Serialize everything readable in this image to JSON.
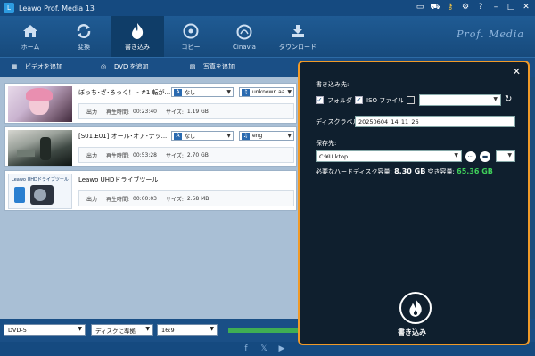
{
  "app": {
    "title": "Leawo Prof. Media 13",
    "brand": "Prof. Media"
  },
  "nav": [
    {
      "label": "ホーム"
    },
    {
      "label": "変換"
    },
    {
      "label": "書き込み"
    },
    {
      "label": "コピー"
    },
    {
      "label": "Cinavia"
    },
    {
      "label": "ダウンロード"
    }
  ],
  "toolbar": {
    "add_video": "ビデオを追加",
    "add_dvd": "DVD を追加",
    "add_photo": "写真を追加"
  },
  "items": [
    {
      "name": "ぼっち･ざ･ろっく！ - #1 転が...",
      "output_label": "出力",
      "duration_label": "再生時間:",
      "duration": "00:23:40",
      "size_label": "サイズ:",
      "size": "1.19 GB",
      "subtitle": "なし",
      "audio": "unknown aa"
    },
    {
      "name": "[S01.E01] オール･オア･ナッ...",
      "output_label": "出力",
      "duration_label": "再生時間:",
      "duration": "00:53:28",
      "size_label": "サイズ:",
      "size": "2.70 GB",
      "subtitle": "なし",
      "audio": "eng"
    },
    {
      "name": "Leawo UHDドライブツール",
      "output_label": "出力",
      "duration_label": "再生時間:",
      "duration": "00:00:03",
      "size_label": "サイズ:",
      "size": "2.58 MB",
      "thumb_text": "Leawo UHDドライブツール"
    }
  ],
  "bottom": {
    "disc_type": "DVD-5",
    "fit": "ディスクに準拠",
    "aspect": "16:9",
    "progress": 1.0
  },
  "dialog": {
    "burn_to_label": "書き込み先:",
    "folder_label": "フォルダ",
    "iso_label": "ISO ファイル",
    "folder_checked": true,
    "iso_checked": true,
    "drive_checked": false,
    "disc_label_title": "ディスクラベル:",
    "disc_label_value": "20250604_14_11_26",
    "save_to_label": "保存先:",
    "save_path": "C:¥U                ktop",
    "more_btn": "···",
    "req_space_label": "必要なハードディスク容量:",
    "req_space_value": "8.30 GB",
    "free_space_label": "空き容量:",
    "free_space_value": "65.36 GB",
    "burn_label": "書き込み"
  },
  "colors": {
    "accent": "#f09a28",
    "free_space": "#3fcf5a",
    "nav_active": "#0f3d68"
  },
  "icons": {
    "nav": [
      "home-icon",
      "convert-icon",
      "burn-icon",
      "copy-icon",
      "cinavia-icon",
      "download-icon"
    ],
    "social": [
      "facebook-icon",
      "x-icon",
      "youtube-icon"
    ]
  }
}
